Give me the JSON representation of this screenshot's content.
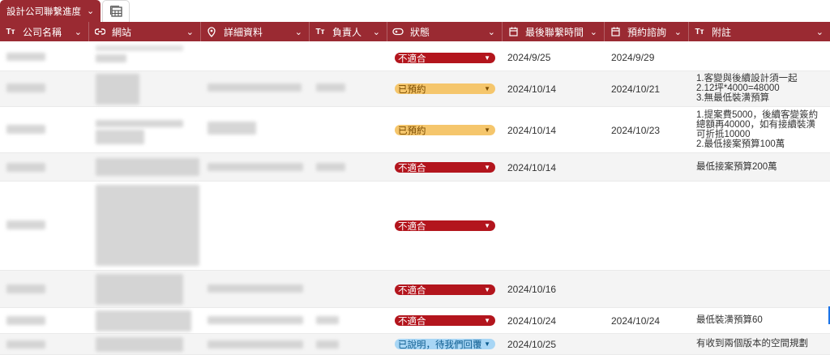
{
  "tab": {
    "name": "設計公司聯繫進度"
  },
  "columns": [
    {
      "label": "公司名稱",
      "icon": "text-type-icon"
    },
    {
      "label": "網站",
      "icon": "link-icon"
    },
    {
      "label": "詳細資料",
      "icon": "location-pin-icon"
    },
    {
      "label": "負責人",
      "icon": "text-type-icon"
    },
    {
      "label": "狀態",
      "icon": "status-icon"
    },
    {
      "label": "最後聯繫時間",
      "icon": "calendar-icon"
    },
    {
      "label": "預約諮詢",
      "icon": "calendar-icon"
    },
    {
      "label": "附註",
      "icon": "text-type-icon"
    }
  ],
  "rows": [
    {
      "status": "不適合",
      "status_color": "#b3151d",
      "last_contact": "2024/9/25",
      "appointment": "2024/9/29",
      "notes": []
    },
    {
      "status": "已預約",
      "status_color": "#f5c66c",
      "last_contact": "2024/10/14",
      "appointment": "2024/10/21",
      "notes": [
        "1.客變與後續設計須一起",
        "2.12坪*4000=48000",
        "3.無最低裝潢預算"
      ]
    },
    {
      "status": "已預約",
      "status_color": "#f5c66c",
      "last_contact": "2024/10/14",
      "appointment": "2024/10/23",
      "notes": [
        "1.提案費5000，後續客變簽約",
        "總額再40000，如有接續裝潢",
        "可折抵10000",
        "2.最低接案預算100萬"
      ]
    },
    {
      "status": "不適合",
      "status_color": "#b3151d",
      "last_contact": "2024/10/14",
      "appointment": "",
      "notes": [
        "最低接案預算200萬"
      ]
    },
    {
      "status": "不適合",
      "status_color": "#b3151d",
      "last_contact": "",
      "appointment": "",
      "notes": []
    },
    {
      "status": "不適合",
      "status_color": "#b3151d",
      "last_contact": "2024/10/16",
      "appointment": "",
      "notes": []
    },
    {
      "status": "不適合",
      "status_color": "#b3151d",
      "last_contact": "2024/10/24",
      "appointment": "2024/10/24",
      "notes": [
        "最低裝潢預算60"
      ]
    },
    {
      "status": "已說明，待我們回覆",
      "status_color": "#a8d6f5",
      "last_contact": "2024/10/25",
      "appointment": "",
      "notes": [
        "有收到兩個版本的空間規劃"
      ]
    }
  ],
  "colors": {
    "header_bg": "#9a2a32",
    "status_red": "#b3151d",
    "status_yellow": "#f5c66c",
    "status_blue": "#a8d6f5"
  }
}
